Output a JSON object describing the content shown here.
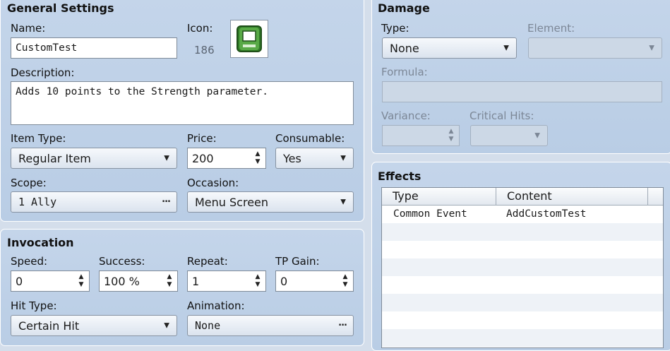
{
  "general": {
    "title": "General Settings",
    "name_label": "Name:",
    "name_value": "CustomTest",
    "icon_label": "Icon:",
    "icon_index": "186",
    "description_label": "Description:",
    "description_value": "Adds 10 points to the Strength parameter.",
    "item_type_label": "Item Type:",
    "item_type_value": "Regular Item",
    "price_label": "Price:",
    "price_value": "200",
    "consumable_label": "Consumable:",
    "consumable_value": "Yes",
    "scope_label": "Scope:",
    "scope_value": "1 Ally",
    "occasion_label": "Occasion:",
    "occasion_value": "Menu Screen",
    "icon_name": "green-book-icon",
    "ellipsis": "···"
  },
  "invocation": {
    "title": "Invocation",
    "speed_label": "Speed:",
    "speed_value": "0",
    "success_label": "Success:",
    "success_value": "100 %",
    "repeat_label": "Repeat:",
    "repeat_value": "1",
    "tp_gain_label": "TP Gain:",
    "tp_gain_value": "0",
    "hit_type_label": "Hit Type:",
    "hit_type_value": "Certain Hit",
    "animation_label": "Animation:",
    "animation_value": "None"
  },
  "damage": {
    "title": "Damage",
    "type_label": "Type:",
    "type_value": "None",
    "element_label": "Element:",
    "formula_label": "Formula:",
    "variance_label": "Variance:",
    "critical_label": "Critical Hits:"
  },
  "effects": {
    "title": "Effects",
    "columns": [
      "Type",
      "Content"
    ],
    "rows": [
      {
        "type": "Common Event",
        "content": "AddCustomTest"
      }
    ]
  },
  "colors": {
    "panel": "#bfd1e8",
    "background": "#d4deeb",
    "disabled_text": "#7c8796",
    "icon_green": "#3a8a2e"
  }
}
